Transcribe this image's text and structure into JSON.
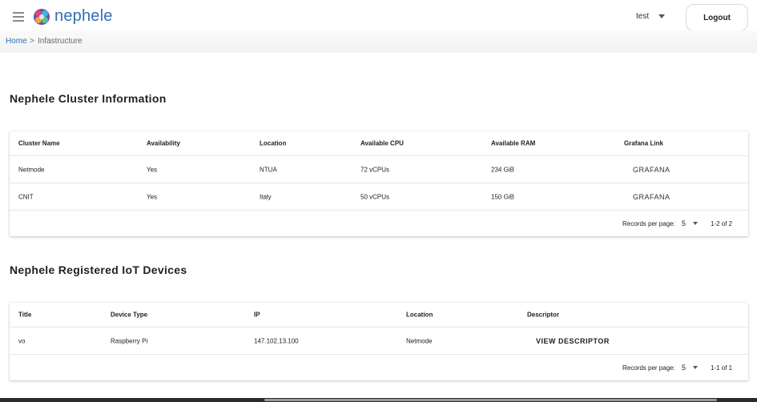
{
  "header": {
    "brand": "nephele",
    "user": "test",
    "logout_label": "Logout"
  },
  "breadcrumb": {
    "home": "Home",
    "separator": ">",
    "current": "Infastructure"
  },
  "clusters": {
    "title": "Nephele Cluster Information",
    "columns": [
      "Cluster Name",
      "Availability",
      "Location",
      "Available CPU",
      "Available RAM",
      "Grafana Link"
    ],
    "rows": [
      {
        "name": "Netmode",
        "availability": "Yes",
        "location": "NTUA",
        "cpu": "72 vCPUs",
        "ram": "234 GiB",
        "link": "GRAFANA"
      },
      {
        "name": "CNIT",
        "availability": "Yes",
        "location": "Italy",
        "cpu": "50 vCPUs",
        "ram": "150 GiB",
        "link": "GRAFANA"
      }
    ],
    "footer": {
      "records_label": "Records per page:",
      "per_page": "5",
      "range": "1-2 of 2"
    }
  },
  "devices": {
    "title": "Nephele Registered IoT Devices",
    "columns": [
      "Title",
      "Device Type",
      "IP",
      "Location",
      "Descriptor"
    ],
    "rows": [
      {
        "title": "vo",
        "type": "Raspberry Pi",
        "ip": "147.102.13.100",
        "location": "Netmode",
        "descriptor": "VIEW DESCRIPTOR"
      }
    ],
    "footer": {
      "records_label": "Records per page:",
      "per_page": "5",
      "range": "1-1 of 1"
    }
  },
  "icons": {
    "menu": "hamburger-menu-icon",
    "logo": "nephele-logo",
    "user_dropdown": "chevron-down-icon",
    "per_page_dropdown": "chevron-down-icon"
  },
  "colors": {
    "brand": "#2f6fb3",
    "link": "#2f6fb3"
  }
}
